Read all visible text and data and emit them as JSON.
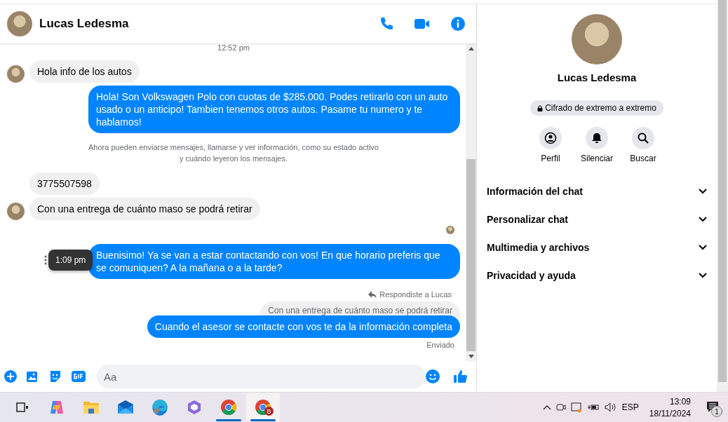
{
  "header": {
    "name": "Lucas Ledesma"
  },
  "messages": [
    {
      "kind": "time",
      "text": "12:52 pm"
    },
    {
      "kind": "incoming",
      "text": "Hola info de los autos",
      "avatar": true
    },
    {
      "kind": "outgoing",
      "text": "Hola! Son Volkswagen Polo con cuotas de $285.000. Podes retirarlo con un auto usado o un anticipo! Tambien tenemos otros autos. Pasame tu numero y te hablamos!"
    },
    {
      "kind": "system",
      "text": "Ahora pueden enviarse mensajes, llamarse y ver información, como su estado activo\ny cuándo leyeron los mensajes."
    },
    {
      "kind": "incoming",
      "text": "3775507598",
      "avatar": false
    },
    {
      "kind": "incoming",
      "text": "Con una entrega de cuánto maso se podrá retirar",
      "avatar": true
    },
    {
      "kind": "seen"
    },
    {
      "kind": "outgoing",
      "text": "Buenisimo! Ya se van a estar contactando con vos! En que horario preferis que se comuniquen? A la mañana o a la tarde?",
      "tooltip": "1:09 pm"
    },
    {
      "kind": "reply_label",
      "text": "Respondiste a Lucas"
    },
    {
      "kind": "quoted",
      "text": "Con una entrega de cuánto maso se podrá retirar"
    },
    {
      "kind": "outgoing",
      "text": "Cuando el asesor se contacte con vos te da la información completa"
    },
    {
      "kind": "status",
      "text": "Enviado"
    }
  ],
  "composer": {
    "placeholder": "Aa"
  },
  "profile": {
    "name": "Lucas Ledesma",
    "encryption": "Cifrado de extremo a extremo",
    "actions": [
      {
        "kind": "profile",
        "label": "Perfil"
      },
      {
        "kind": "mute",
        "label": "Silenciar"
      },
      {
        "kind": "search",
        "label": "Buscar"
      }
    ],
    "sections": [
      {
        "label": "Información del chat",
        "expanded": false
      },
      {
        "label": "Personalizar chat",
        "expanded": false
      },
      {
        "label": "Multimedia y archivos",
        "expanded": false
      },
      {
        "label": "Privacidad y ayuda",
        "expanded": false
      }
    ]
  },
  "taskbar": {
    "apps": [
      {
        "kind": "taskview",
        "running": false,
        "selected": false
      },
      {
        "kind": "copilot",
        "running": false,
        "selected": false
      },
      {
        "kind": "folder",
        "running": false,
        "selected": false
      },
      {
        "kind": "mail",
        "running": false,
        "selected": false
      },
      {
        "kind": "edge",
        "running": false,
        "selected": false
      },
      {
        "kind": "m365",
        "running": false,
        "selected": false
      },
      {
        "kind": "browser_person",
        "running": true,
        "selected": false
      },
      {
        "kind": "browser_badge",
        "running": true,
        "selected": true,
        "badge": "B"
      }
    ],
    "language": "ESP",
    "time": "13:09",
    "date": "18/11/2024",
    "notifications": "1"
  }
}
